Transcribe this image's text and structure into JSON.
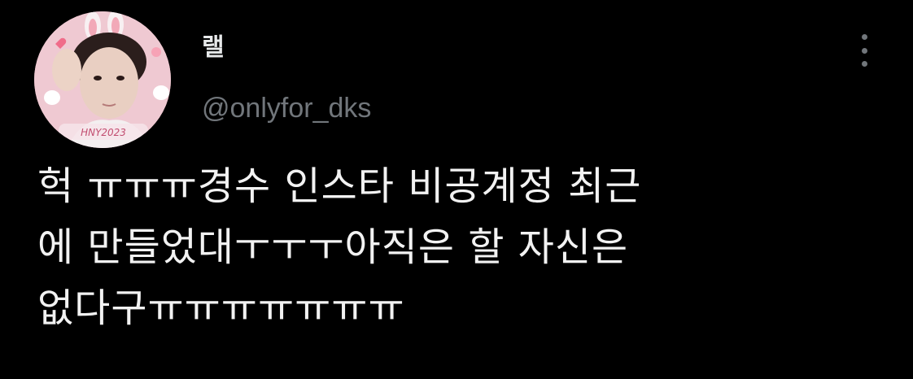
{
  "tweet": {
    "display_name": "랠",
    "handle": "@onlyfor_dks",
    "more_icon": "more-vertical-icon",
    "avatar_text": "HNY2023",
    "text_lines": [
      "헉 ㅠㅠㅠ경수 인스타 비공계정 최근",
      "에 만들었대ㅜㅜㅜ아직은 할 자신은",
      "없다구ㅠㅠㅠㅠㅠㅠㅠ"
    ]
  },
  "colors": {
    "background": "#000000",
    "primary_text": "#e7e9ea",
    "secondary_text": "#71767b"
  }
}
